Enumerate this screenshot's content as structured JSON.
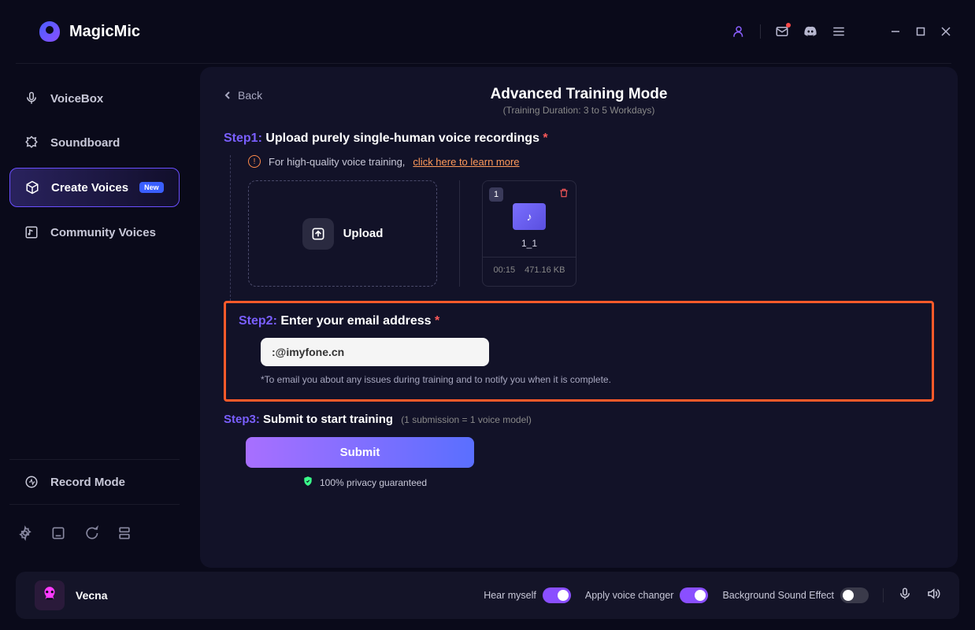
{
  "app": {
    "title": "MagicMic"
  },
  "sidebar": {
    "items": [
      {
        "label": "VoiceBox"
      },
      {
        "label": "Soundboard"
      },
      {
        "label": "Create Voices",
        "badge": "New"
      },
      {
        "label": "Community Voices"
      }
    ],
    "record_mode": "Record Mode"
  },
  "panel": {
    "back": "Back",
    "title": "Advanced Training Mode",
    "subtitle": "(Training Duration: 3 to 5 Workdays)"
  },
  "step1": {
    "prefix": "Step1: ",
    "title": "Upload purely single-human voice recordings ",
    "hint_prefix": "For high-quality voice training, ",
    "hint_link": "click here to learn more",
    "upload_label": "Upload",
    "file": {
      "index": "1",
      "name": "1_1",
      "duration": "00:15",
      "size": "471.16 KB"
    }
  },
  "step2": {
    "prefix": "Step2: ",
    "title": "Enter your email address ",
    "email_value": ":@imyfone.cn",
    "note": "*To email you about any issues during training and to notify you when it is complete."
  },
  "step3": {
    "prefix": "Step3: ",
    "title": "Submit to start training",
    "note": "(1 submission = 1 voice model)",
    "submit_label": "Submit",
    "privacy": "100% privacy guaranteed"
  },
  "bottombar": {
    "voice_name": "Vecna",
    "hear_myself": "Hear myself",
    "apply_voice_changer": "Apply voice changer",
    "bg_sound": "Background Sound Effect"
  }
}
